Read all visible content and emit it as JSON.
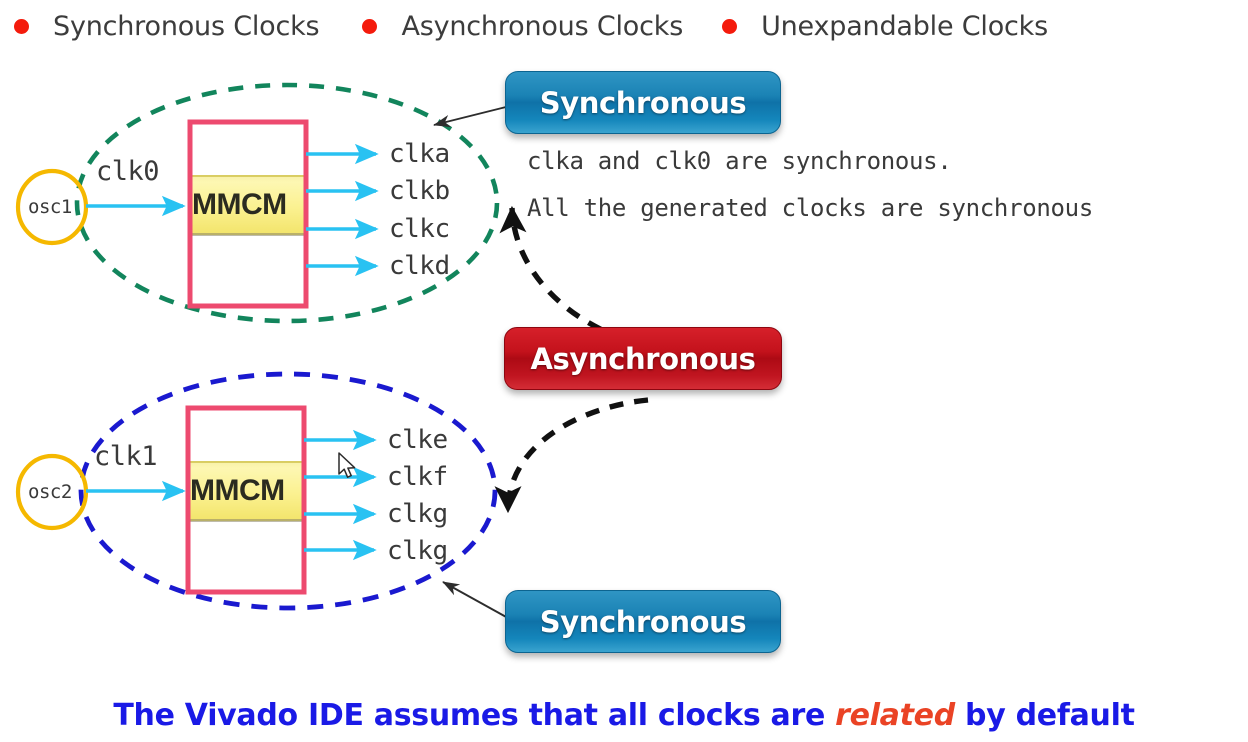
{
  "header": {
    "items": [
      {
        "label": "Synchronous Clocks",
        "bullet_color": "#f41b0c"
      },
      {
        "label": "Asynchronous Clocks",
        "bullet_color": "#f41b0c"
      },
      {
        "label": "Unexpandable Clocks",
        "bullet_color": "#f41b0c"
      }
    ]
  },
  "diagram": {
    "group_top": {
      "ellipse_color": "#12855c",
      "ellipse_style": "dashed",
      "oscillator": {
        "label": "osc1",
        "border_color": "#f5b800"
      },
      "input_clock": "clk0",
      "block": {
        "label": "MMCM",
        "border_color": "#ed4a6f",
        "band_color": "#faf08a"
      },
      "outputs": [
        "clka",
        "clkb",
        "clkc",
        "clkd"
      ],
      "arrow_color": "#29c2f2"
    },
    "group_bottom": {
      "ellipse_color": "#1a19cf",
      "ellipse_style": "dashed",
      "oscillator": {
        "label": "osc2",
        "border_color": "#f5b800"
      },
      "input_clock": "clk1",
      "block": {
        "label": "MMCM",
        "border_color": "#ed4a6f",
        "band_color": "#faf08a"
      },
      "outputs": [
        "clke",
        "clkf",
        "clkg",
        "clkg"
      ],
      "arrow_color": "#29c2f2"
    }
  },
  "callouts": {
    "synchronous_top": {
      "label": "Synchronous",
      "color": "#0f72a8"
    },
    "asynchronous": {
      "label": "Asynchronous",
      "color": "#c4121c"
    },
    "synchronous_bottom": {
      "label": "Synchronous",
      "color": "#0f72a8"
    }
  },
  "notes": {
    "line1": "clka and clk0 are synchronous.",
    "line2": "All the generated clocks are synchronous"
  },
  "caption": {
    "part1": "The Vivado IDE assumes that all clocks are ",
    "emphasis": "related",
    "part2": " by default",
    "color": "#1a1ae6",
    "emphasis_color": "#ea4325"
  }
}
